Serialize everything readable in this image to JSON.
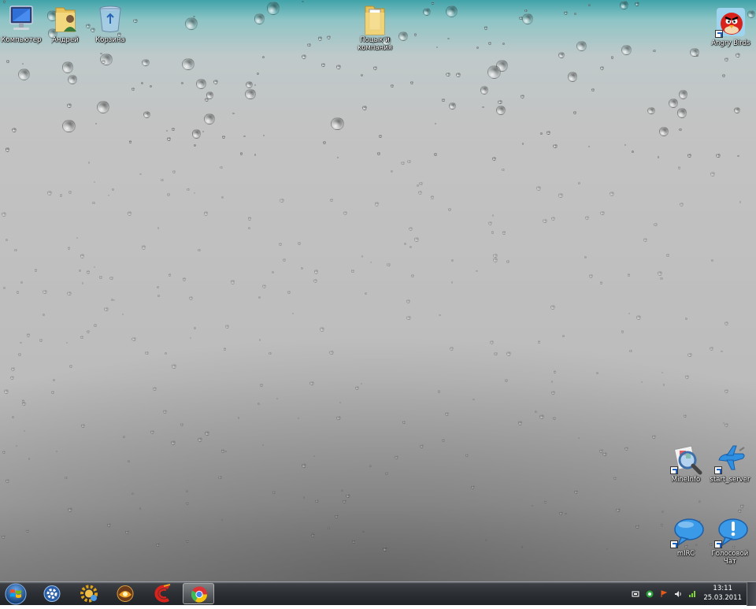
{
  "desktop": {
    "icons": {
      "computer": "Компьютер",
      "user": "Андрей",
      "recycle": "Корзина",
      "folder": "Поцык и\nкомпания",
      "angry_birds": "Angry Birds",
      "mineinfo": "MineInfo",
      "start_server": "start_server",
      "mirc": "mIRC",
      "voice_chat": "Голосовой\nЧат"
    }
  },
  "taskbar": {
    "clock_time": "13:11",
    "clock_date": "25.03.2011",
    "pinned": [
      "settings-icon",
      "gear-app-icon",
      "media-player-icon",
      "ccleaner-icon",
      "chrome-icon"
    ],
    "active": "chrome-icon"
  },
  "colors": {
    "wallpaper_top": "#3fa3a9",
    "wallpaper_mid": "#bcbcbc",
    "taskbar": "#2c3035"
  }
}
